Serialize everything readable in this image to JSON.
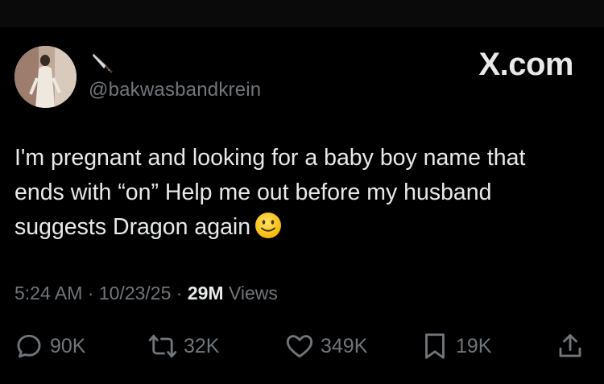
{
  "author": {
    "avatar_icon": "profile-photo",
    "name_icon": "kitchen-knife-icon",
    "handle": "@bakwasbandkrein"
  },
  "brand": "X.com",
  "tweet": {
    "text": "I'm pregnant and looking for a baby boy name that ends with “on” Help me out before my husband suggests Dragon again",
    "emoji": "slightly-smiling-face-emoji"
  },
  "meta": {
    "time": "5:24 AM",
    "date": "10/23/25",
    "views_count": "29M",
    "views_label": "Views",
    "separator": "·"
  },
  "actions": {
    "replies": "90K",
    "reposts": "32K",
    "likes": "349K",
    "bookmarks": "19K"
  },
  "colors": {
    "background": "#000000",
    "text": "#e7e9ea",
    "muted": "#71767b"
  }
}
